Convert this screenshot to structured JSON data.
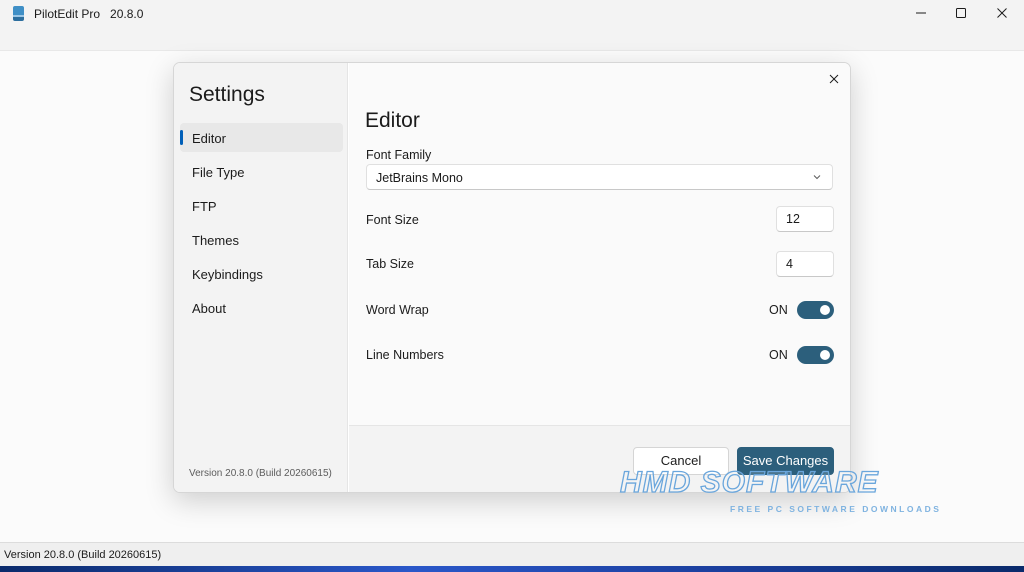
{
  "window": {
    "app_name": "PilotEdit Pro",
    "version": "20.8.0",
    "title_text": "PilotEdit Pro   20.8.0"
  },
  "status_bar": {
    "text": "Version 20.8.0 (Build 20260615)"
  },
  "settings": {
    "heading": "Settings",
    "nav": [
      {
        "label": "Editor",
        "active": true
      },
      {
        "label": "File Type",
        "active": false
      },
      {
        "label": "FTP",
        "active": false
      },
      {
        "label": "Themes",
        "active": false
      },
      {
        "label": "Keybindings",
        "active": false
      },
      {
        "label": "About",
        "active": false
      }
    ],
    "version_text": "Version 20.8.0 (Build 20260615)",
    "section_title": "Editor",
    "font_family": {
      "label": "Font Family",
      "value": "JetBrains Mono"
    },
    "font_size": {
      "label": "Font Size",
      "value": "12"
    },
    "tab_size": {
      "label": "Tab Size",
      "value": "4"
    },
    "word_wrap": {
      "label": "Word Wrap",
      "state": "ON"
    },
    "line_numbers": {
      "label": "Line Numbers",
      "state": "ON"
    },
    "cancel_label": "Cancel",
    "save_label": "Save Changes"
  },
  "watermark": {
    "main": "HMD SOFTWARE",
    "sub": "FREE PC SOFTWARE DOWNLOADS"
  },
  "colors": {
    "accent": "#2c5f7c",
    "nav_indicator": "#005fb8"
  },
  "icons": {
    "app": "app-book-icon",
    "minimize": "minimize-icon",
    "maximize": "maximize-icon",
    "close": "close-icon",
    "dropdown": "chevron-down-icon"
  }
}
